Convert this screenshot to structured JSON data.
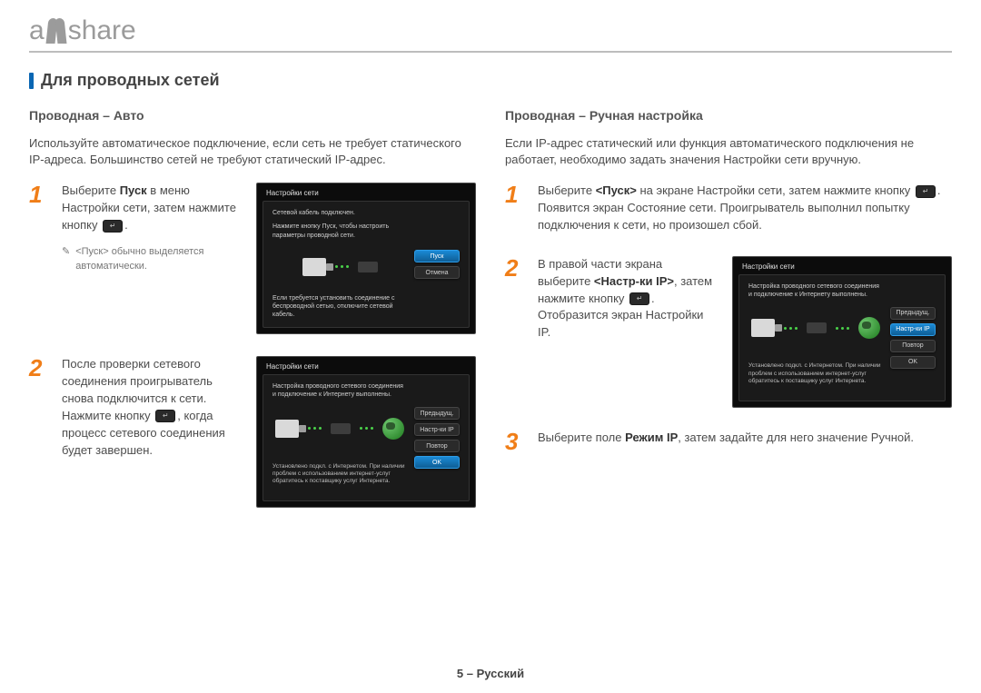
{
  "logo": {
    "pre": "a",
    "post": "share"
  },
  "section_title": "Для проводных сетей",
  "footer": "5 – Русский",
  "left": {
    "subhead": "Проводная – Авто",
    "intro": "Используйте автоматическое подключение, если сеть не требует статического IP-адреса. Большинство сетей не требуют статический IP-адрес.",
    "step1": {
      "num": "1",
      "text_a": "Выберите ",
      "text_b": "Пуск",
      "text_c": " в меню Настройки сети, затем нажмите кнопку ",
      "text_d": "."
    },
    "note": {
      "a": "<Пуск>",
      "b": " обычно выделяется автоматически."
    },
    "step2": {
      "num": "2",
      "text_a": "После проверки сетевого соединения проигрыватель снова подключится к сети. Нажмите кнопку ",
      "text_b": ", когда процесс сетевого соединения будет завершен."
    },
    "shot1": {
      "title": "Настройки сети",
      "d1": "Сетевой кабель подключен.",
      "d2": "Нажмите кнопку Пуск, чтобы настроить параметры проводной сети.",
      "d3": "Если требуется установить соединение с беспроводной сетью, отключите сетевой кабель.",
      "b1": "Пуск",
      "b2": "Отмена"
    },
    "shot2": {
      "title": "Настройки сети",
      "d1": "Настройка проводного сетевого соединения и подключение к Интернету выполнены.",
      "d2": "Установлено подкл. с Интернетом. При наличии проблем с использованием интернет-услуг обратитесь к поставщику услуг Интернета.",
      "b1": "Предыдущ.",
      "b2": "Настр-ки IP",
      "b3": "Повтор",
      "b4": "OK"
    }
  },
  "right": {
    "subhead": "Проводная – Ручная настройка",
    "intro": "Если IP-адрес статический или функция автоматического подключения не работает, необходимо задать значения Настройки сети вручную.",
    "step1": {
      "num": "1",
      "text_a": "Выберите ",
      "text_b": "<Пуск>",
      "text_c": " на экране Настройки сети, затем нажмите кнопку ",
      "text_d": ". Появится экран Состояние сети. Проигрыватель выполнил попытку подключения к сети, но произошел сбой."
    },
    "step2": {
      "num": "2",
      "text_a": "В правой части экрана выберите ",
      "text_b": "<Настр-ки IP>",
      "text_c": ", затем нажмите кнопку ",
      "text_d": ". Отобразится экран Настройки IP."
    },
    "step3": {
      "num": "3",
      "text_a": "Выберите поле ",
      "text_b": "Режим IP",
      "text_c": ", затем задайте для него значение Ручной."
    },
    "shot1": {
      "title": "Настройки сети",
      "d1": "Настройка проводного сетевого соединения и подключение к Интернету выполнены.",
      "d2": "Установлено подкл. с Интернетом. При наличии проблем с использованием интернет-услуг обратитесь к поставщику услуг Интернета.",
      "b1": "Предыдущ.",
      "b2": "Настр-ки IP",
      "b3": "Повтор",
      "b4": "OK"
    }
  }
}
